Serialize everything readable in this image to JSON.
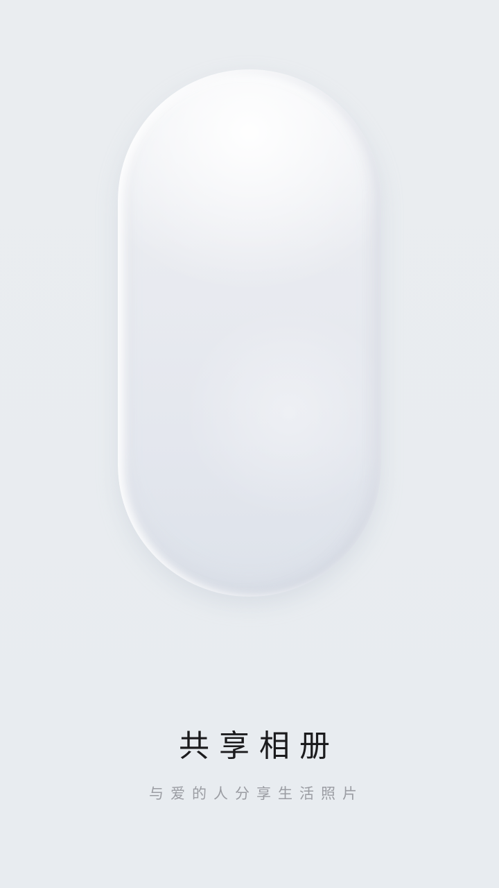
{
  "splash": {
    "title": "共享相册",
    "subtitle": "与爱的人分享生活照片"
  },
  "colors": {
    "background": "#e9edf1",
    "title_text": "#1b1b1d",
    "subtitle_text": "#9a9ca2"
  },
  "icons": {
    "pill_illustration": "rounded-capsule-illustration"
  }
}
